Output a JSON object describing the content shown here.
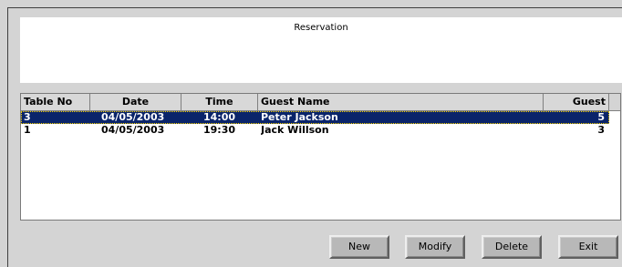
{
  "panel": {
    "title": "Reservation"
  },
  "table": {
    "columns": [
      "Table No",
      "Date",
      "Time",
      "Guest Name",
      "Guest"
    ],
    "rows": [
      {
        "table_no": "3",
        "date": "04/05/2003",
        "time": "14:00",
        "guest_name": "Peter Jackson",
        "guests": "5",
        "selected": true
      },
      {
        "table_no": "1",
        "date": "04/05/2003",
        "time": "19:30",
        "guest_name": "Jack Willson",
        "guests": "3",
        "selected": false
      }
    ]
  },
  "buttons": {
    "new": "New",
    "modify": "Modify",
    "delete": "Delete",
    "exit": "Exit"
  },
  "colors": {
    "selection": "#0a246a",
    "background": "#d4d4d4"
  }
}
